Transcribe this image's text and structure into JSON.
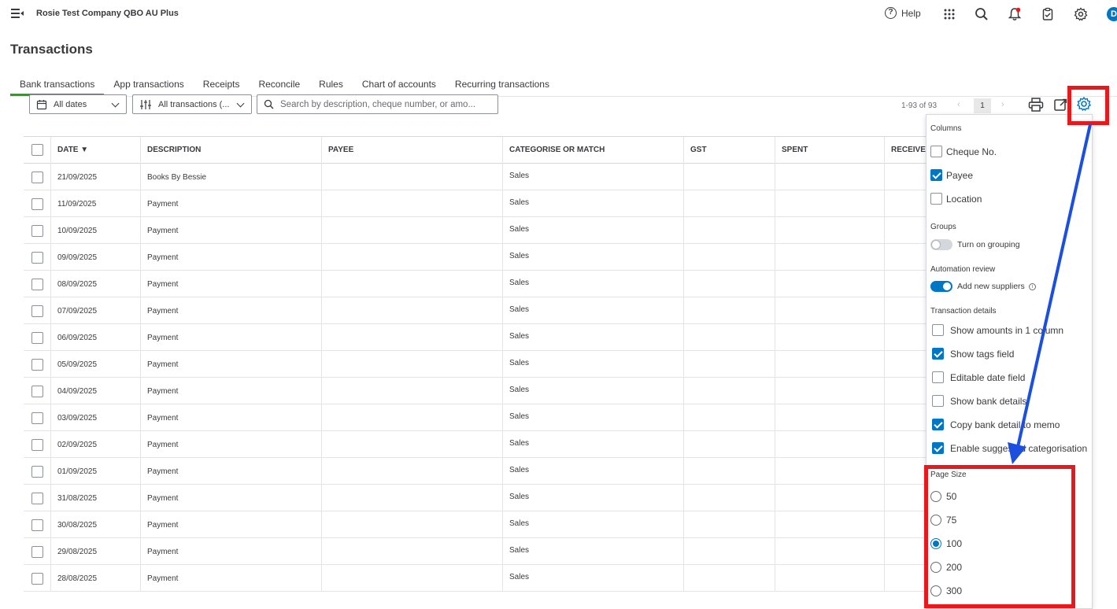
{
  "app": {
    "company": "Rosie Test Company QBO AU Plus",
    "help_label": "Help",
    "avatar_letter": "D"
  },
  "page": {
    "title": "Transactions"
  },
  "tabs": [
    {
      "label": "Bank transactions",
      "active": true
    },
    {
      "label": "App transactions",
      "active": false
    },
    {
      "label": "Receipts",
      "active": false
    },
    {
      "label": "Reconcile",
      "active": false
    },
    {
      "label": "Rules",
      "active": false
    },
    {
      "label": "Chart of accounts",
      "active": false
    },
    {
      "label": "Recurring transactions",
      "active": false
    }
  ],
  "filters": {
    "dates": "All dates",
    "transactions": "All transactions (...",
    "search_placeholder": "Search by description, cheque number, or amo..."
  },
  "pager": {
    "range": "1-93 of 93",
    "prev": "‹",
    "page": "1",
    "next": "›"
  },
  "table": {
    "headers": {
      "date": "DATE ▼",
      "description": "DESCRIPTION",
      "payee": "PAYEE",
      "categorise": "CATEGORISE OR MATCH",
      "gst": "GST",
      "spent": "SPENT",
      "received": "RECEIVED"
    },
    "rows": [
      {
        "date": "21/09/2025",
        "description": "Books By Bessie",
        "category": "Sales"
      },
      {
        "date": "11/09/2025",
        "description": "Payment",
        "category": "Sales"
      },
      {
        "date": "10/09/2025",
        "description": "Payment",
        "category": "Sales"
      },
      {
        "date": "09/09/2025",
        "description": "Payment",
        "category": "Sales"
      },
      {
        "date": "08/09/2025",
        "description": "Payment",
        "category": "Sales"
      },
      {
        "date": "07/09/2025",
        "description": "Payment",
        "category": "Sales"
      },
      {
        "date": "06/09/2025",
        "description": "Payment",
        "category": "Sales"
      },
      {
        "date": "05/09/2025",
        "description": "Payment",
        "category": "Sales"
      },
      {
        "date": "04/09/2025",
        "description": "Payment",
        "category": "Sales"
      },
      {
        "date": "03/09/2025",
        "description": "Payment",
        "category": "Sales"
      },
      {
        "date": "02/09/2025",
        "description": "Payment",
        "category": "Sales"
      },
      {
        "date": "01/09/2025",
        "description": "Payment",
        "category": "Sales"
      },
      {
        "date": "31/08/2025",
        "description": "Payment",
        "category": "Sales"
      },
      {
        "date": "30/08/2025",
        "description": "Payment",
        "category": "Sales"
      },
      {
        "date": "29/08/2025",
        "description": "Payment",
        "category": "Sales"
      },
      {
        "date": "28/08/2025",
        "description": "Payment",
        "category": "Sales"
      }
    ]
  },
  "settings": {
    "columns_title": "Columns",
    "columns": [
      {
        "label": "Cheque No.",
        "checked": false
      },
      {
        "label": "Payee",
        "checked": true
      },
      {
        "label": "Location",
        "checked": false
      }
    ],
    "groups_title": "Groups",
    "grouping_label": "Turn on grouping",
    "grouping_on": false,
    "automation_title": "Automation review",
    "suppliers_label": "Add new suppliers",
    "suppliers_on": true,
    "details_title": "Transaction details",
    "details": [
      {
        "label": "Show amounts in 1 column",
        "checked": false
      },
      {
        "label": "Show tags field",
        "checked": true
      },
      {
        "label": "Editable date field",
        "checked": false
      },
      {
        "label": "Show bank details",
        "checked": false
      },
      {
        "label": "Copy bank detail to memo",
        "checked": true
      },
      {
        "label": "Enable suggested categorisation",
        "checked": true
      }
    ],
    "page_size_title": "Page Size",
    "page_sizes": [
      {
        "label": "50",
        "selected": false
      },
      {
        "label": "75",
        "selected": false
      },
      {
        "label": "100",
        "selected": true
      },
      {
        "label": "200",
        "selected": false
      },
      {
        "label": "300",
        "selected": false
      }
    ]
  },
  "colors": {
    "accent": "#0077c5",
    "tab_active": "#2ca01c",
    "highlight": "#e8191d",
    "arrow": "#1a4fe0"
  }
}
